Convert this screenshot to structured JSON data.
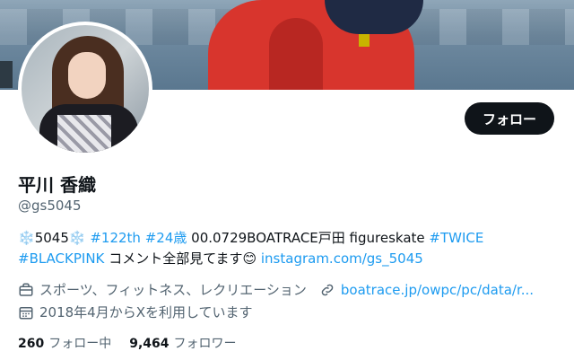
{
  "profile": {
    "display_name": "平川 香織",
    "handle": "@gs5045",
    "follow_label": "フォロー"
  },
  "bio": {
    "snow1": "❄️",
    "num": "5045",
    "snow2": "❄️",
    "tag1": "#122th",
    "tag2": "#24歳",
    "text1": "00.0729BOATRACE戸田 figureskate",
    "tag3": "#TWICE",
    "tag4": "#BLACKPINK",
    "text2": "コメント全部見てます",
    "emoji": "😊",
    "link": "instagram.com/gs_5045"
  },
  "meta": {
    "category": "スポーツ、フィットネス、レクリエーション",
    "website": "boatrace.jp/owpc/pc/data/r...",
    "joined": "2018年4月からXを利用しています"
  },
  "stats": {
    "following_count": "260",
    "following_label": "フォロー中",
    "followers_count": "9,464",
    "followers_label": "フォロワー"
  },
  "colors": {
    "accent": "#1d9bf0",
    "text": "#0f1419",
    "muted": "#536471"
  },
  "icons": [
    "briefcase-icon",
    "link-icon",
    "calendar-icon"
  ]
}
